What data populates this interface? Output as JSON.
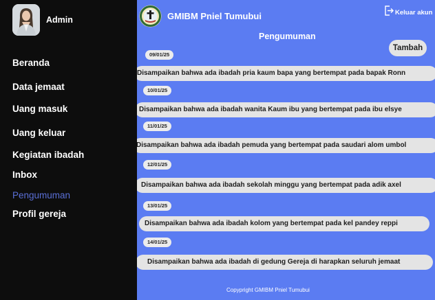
{
  "sidebar": {
    "admin_name": "Admin",
    "items": [
      {
        "label": "Beranda",
        "active": false
      },
      {
        "label": "Data jemaat",
        "active": false
      },
      {
        "label": "Uang masuk",
        "active": false
      },
      {
        "label": "Uang keluar",
        "active": false
      },
      {
        "label": "Kegiatan ibadah",
        "active": false
      },
      {
        "label": "Inbox",
        "active": false
      },
      {
        "label": "Pengumuman",
        "active": true
      },
      {
        "label": "Profil gereja",
        "active": false
      }
    ]
  },
  "header": {
    "title": "GMIBM Pniel Tumubui",
    "logout_label": "Keluar akun",
    "logout_icon": "logout-icon",
    "logo_icon": "church-seal-logo"
  },
  "main": {
    "page_title": "Pengumuman",
    "add_button": "Tambah",
    "announcements": [
      {
        "date": "09/01/25",
        "text": "Disampaikan bahwa ada ibadah pria kaum bapa yang bertempat pada bapak Ronn"
      },
      {
        "date": "10/01/25",
        "text": "Disampaikan bahwa ada ibadah wanita Kaum ibu yang bertempat pada ibu elsye"
      },
      {
        "date": "11/01/25",
        "text": "Disampaikan bahwa ada ibadah pemuda yang bertempat pada saudari alom umbol"
      },
      {
        "date": "12/01/25",
        "text": "Disampaikan bahwa ada ibadah sekolah minggu yang bertempat pada adik axel"
      },
      {
        "date": "13/01/25",
        "text": "Disampaikan bahwa ada ibadah kolom  yang bertempat pada kel pandey reppi"
      },
      {
        "date": "14/01/25",
        "text": "Disampaikan bahwa ada ibadah di gedung Gereja di harapkan seluruh jemaat"
      }
    ],
    "footer": "Copypright GMIBM Pniel Tumubui"
  },
  "colors": {
    "sidebar_bg": "#0d0d0d",
    "main_bg": "#5b7cf2",
    "active_nav": "#5a6fd6",
    "pill_bg": "#e4e4e4"
  }
}
